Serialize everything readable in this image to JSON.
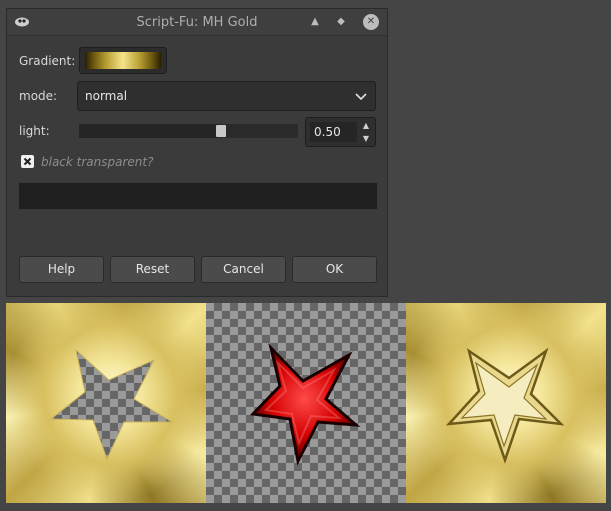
{
  "dialog": {
    "title": "Script-Fu: MH Gold",
    "gradient_label": "Gradient:",
    "mode_label": "mode:",
    "mode_value": "normal",
    "light_label": "light:",
    "light_value": "0.50",
    "light_fraction": 0.65,
    "checkbox_label": "black transparent?",
    "checkbox_checked": true,
    "buttons": {
      "help": "Help",
      "reset": "Reset",
      "cancel": "Cancel",
      "ok": "OK"
    }
  },
  "colors": {
    "gold_light": "#f7eaa0",
    "gold_dark": "#8f7724",
    "star_red": "#d40000"
  },
  "icons": {
    "app": "gimp-icon",
    "shade": "shade-icon",
    "restore": "restore-icon",
    "close": "close-icon",
    "combo": "chevron-down-icon",
    "spin_up": "chevron-up-icon",
    "spin_down": "chevron-down-icon"
  },
  "preview": {
    "panels": [
      "gold-cutout",
      "red-star",
      "gold-star"
    ]
  }
}
